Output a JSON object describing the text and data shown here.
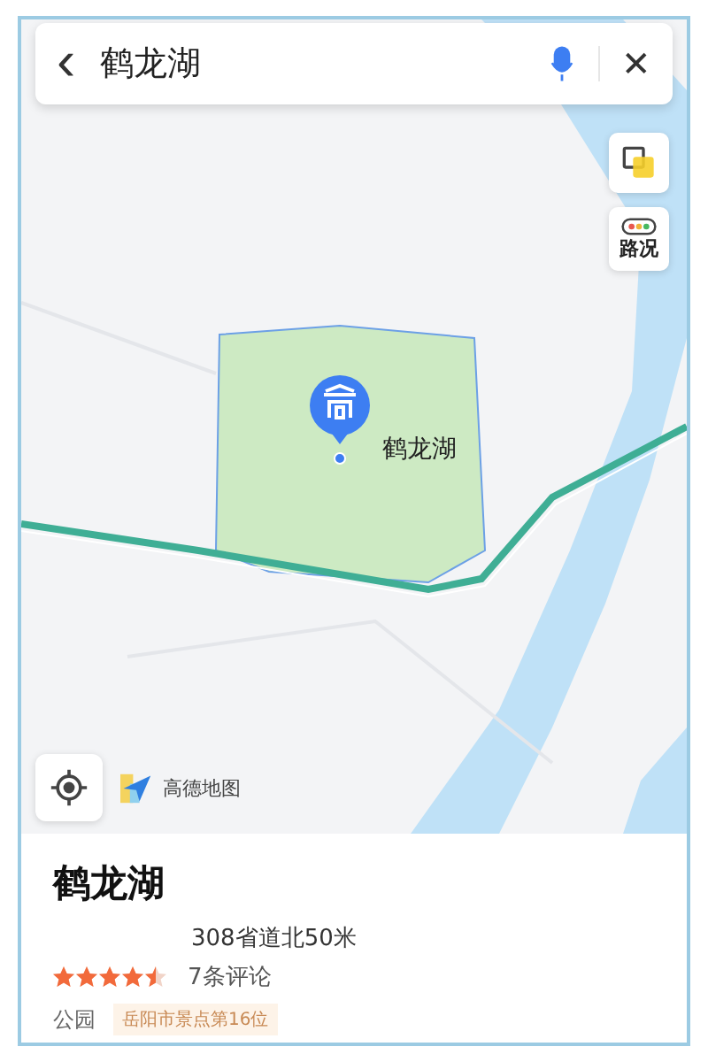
{
  "search": {
    "value": "鹤龙湖",
    "back": "‹",
    "close": "✕"
  },
  "map_controls": [
    {
      "kind": "layers"
    },
    {
      "kind": "traffic",
      "label": "路况"
    }
  ],
  "marker": {
    "label": "鹤龙湖"
  },
  "map_logo": "高德地图",
  "place": {
    "name": "鹤龙湖",
    "address": "308省道北50米",
    "stars": 4.5,
    "reviews": "7条评论",
    "category": "公园",
    "rank_tag": "岳阳市景点第16位"
  }
}
